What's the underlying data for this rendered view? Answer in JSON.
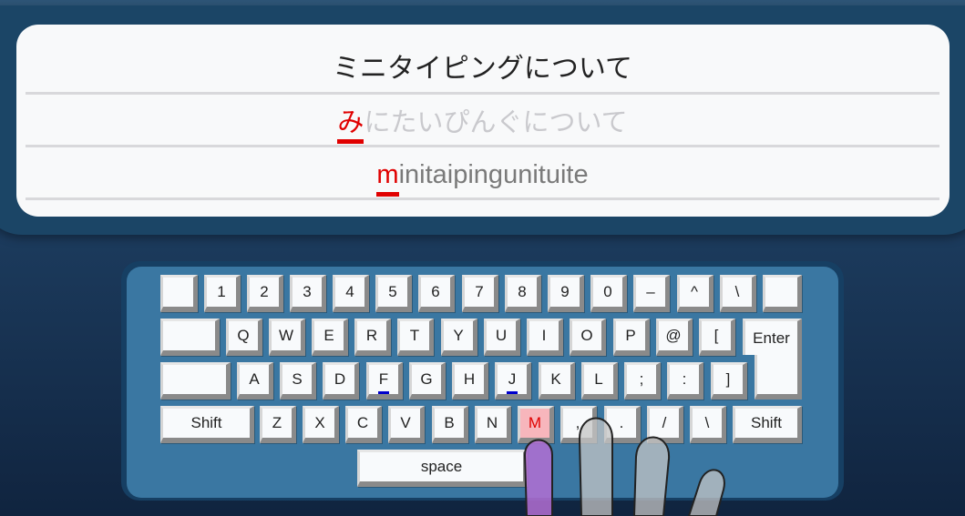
{
  "prompt": {
    "title": "ミニタイピングについて",
    "kana_current": "み",
    "kana_rest": "にたいぴんぐについて",
    "romaji_current": "m",
    "romaji_rest": "initaipingunituite"
  },
  "keyboard": {
    "row1": [
      "",
      "1",
      "2",
      "3",
      "4",
      "5",
      "6",
      "7",
      "8",
      "9",
      "0",
      "–",
      "^",
      "\\",
      ""
    ],
    "row2": [
      "",
      "Q",
      "W",
      "E",
      "R",
      "T",
      "Y",
      "U",
      "I",
      "O",
      "P",
      "@",
      "["
    ],
    "enter": "Enter",
    "row3": [
      "",
      "A",
      "S",
      "D",
      "F",
      "G",
      "H",
      "J",
      "K",
      "L",
      ";",
      ":",
      "]"
    ],
    "row4": [
      "Shift",
      "Z",
      "X",
      "C",
      "V",
      "B",
      "N",
      "M",
      ",",
      ".",
      "/",
      "\\",
      "Shift"
    ],
    "space": "space",
    "highlighted_key": "M",
    "home_keys": [
      "F",
      "J"
    ]
  },
  "colors": {
    "accent": "#e00000",
    "highlight_key_bg": "#f7b6bc",
    "home_marker": "#0000cc",
    "keyboard_bg": "#3a77a2",
    "finger_active": "#b36fd4"
  },
  "icons": {
    "hand": "guide-hand-icon"
  }
}
